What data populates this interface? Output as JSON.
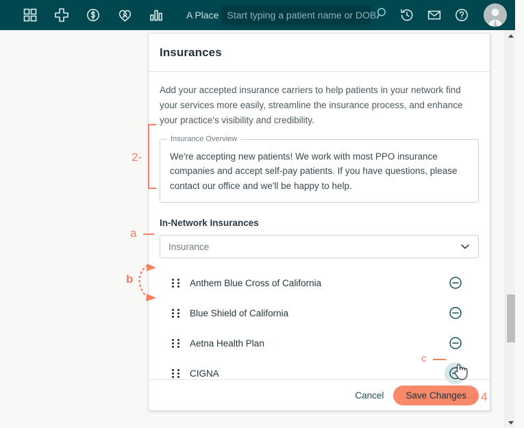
{
  "topbar": {
    "place_label": "A Place",
    "search": {
      "placeholder": "Start typing a patient name or DOB"
    },
    "icons": {
      "dashboard": "grid-icon",
      "add": "plus-icon",
      "billing": "dollar-circle-icon",
      "patients": "heart-person-icon",
      "reports": "bar-chart-icon",
      "search": "search-icon",
      "history": "history-clock-icon",
      "mail": "envelope-icon",
      "help": "question-circle-icon",
      "avatar": "user-avatar"
    }
  },
  "card": {
    "title": "Insurances",
    "description": "Add your accepted insurance carriers to help patients in your network find your services more easily, streamline the insurance process, and enhance your practice's visibility and credibility.",
    "overview": {
      "legend": "Insurance Overview",
      "value": "We're accepting new patients! We work with most PPO insurance companies and accept self-pay patients. If you have questions, please contact our office and we'll be happy to help."
    },
    "in_network": {
      "label": "In-Network Insurances",
      "select_value": "Insurance",
      "items": [
        {
          "name": "Anthem Blue Cross of California"
        },
        {
          "name": "Blue Shield of California"
        },
        {
          "name": "Aetna Health Plan"
        },
        {
          "name": "CIGNA"
        }
      ]
    },
    "footer": {
      "cancel_label": "Cancel",
      "save_label": "Save Changes"
    }
  },
  "annotations": {
    "overview_marker": "2-",
    "select_marker": "a",
    "drag_marker": "b",
    "remove_marker": "c",
    "save_marker": "4"
  },
  "colors": {
    "topbar": "#004750",
    "accent": "#f58061",
    "save_button": "#f9896b",
    "text_dark": "#22323a",
    "page_background": "#f8f8f7"
  }
}
